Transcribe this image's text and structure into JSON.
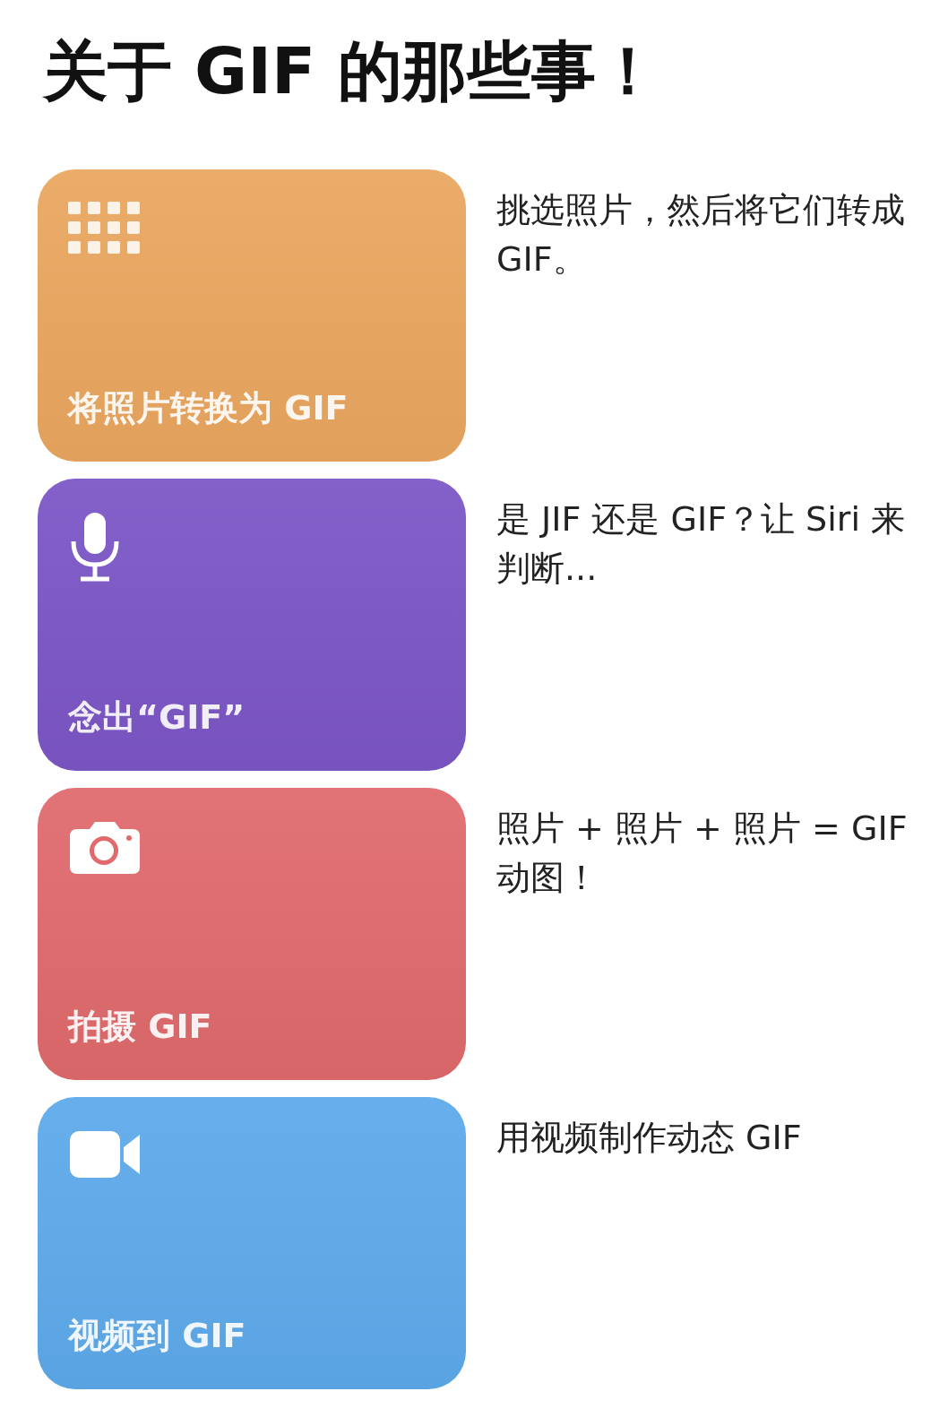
{
  "title": "关于 GIF 的那些事！",
  "shortcuts": [
    {
      "kind": "grid",
      "color": "#eaa760",
      "label": "将照片转换为 GIF",
      "description": "挑选照片，然后将它们转成 GIF。"
    },
    {
      "kind": "microphone",
      "color": "#7c56c6",
      "label": "念出“GIF”",
      "description": "是 JIF 还是 GIF？让 Siri 来判断..."
    },
    {
      "kind": "camera",
      "color": "#e06a6d",
      "label": "拍摄 GIF",
      "description": "照片 + 照片 + 照片 = GIF 动图！"
    },
    {
      "kind": "video",
      "color": "#5eaaeb",
      "label": "视频到 GIF",
      "description": "用视频制作动态 GIF"
    }
  ]
}
